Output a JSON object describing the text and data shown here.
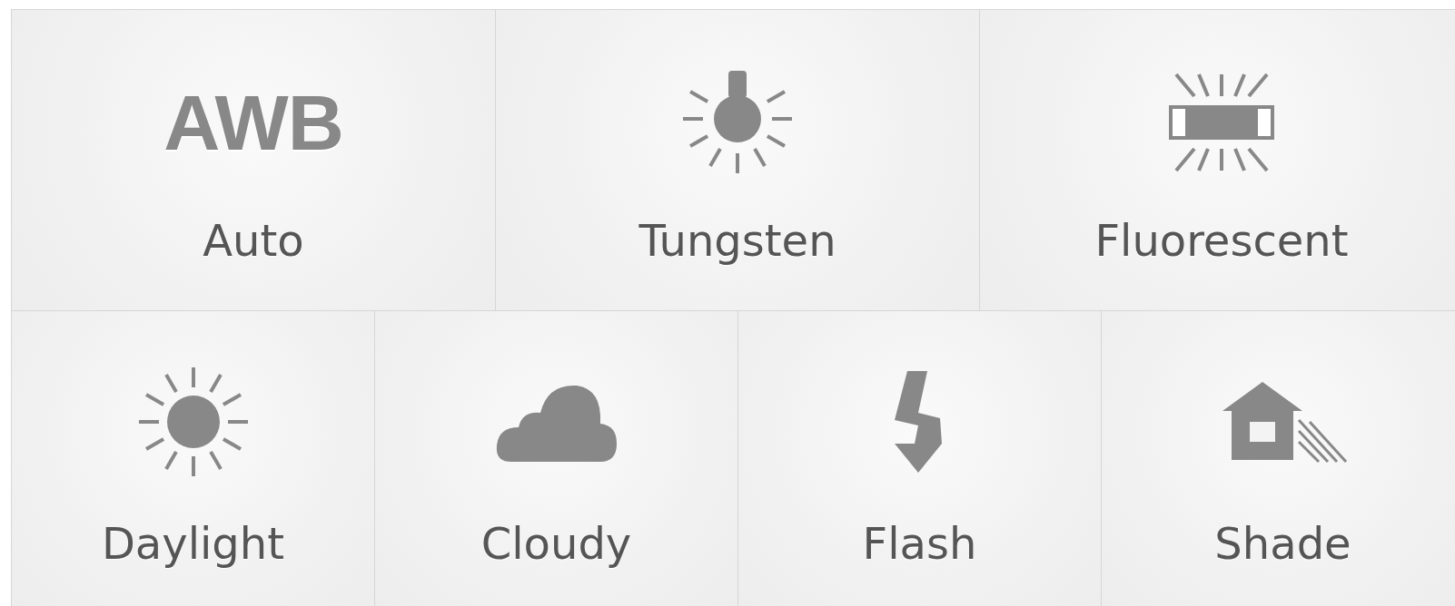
{
  "rows": [
    [
      {
        "kind": "awb",
        "badge": "AWB",
        "label": "Auto"
      },
      {
        "kind": "tungsten",
        "label": "Tungsten"
      },
      {
        "kind": "fluorescent",
        "label": "Fluorescent"
      }
    ],
    [
      {
        "kind": "daylight",
        "label": "Daylight"
      },
      {
        "kind": "cloudy",
        "label": "Cloudy"
      },
      {
        "kind": "flash",
        "label": "Flash"
      },
      {
        "kind": "shade",
        "label": "Shade"
      }
    ]
  ]
}
